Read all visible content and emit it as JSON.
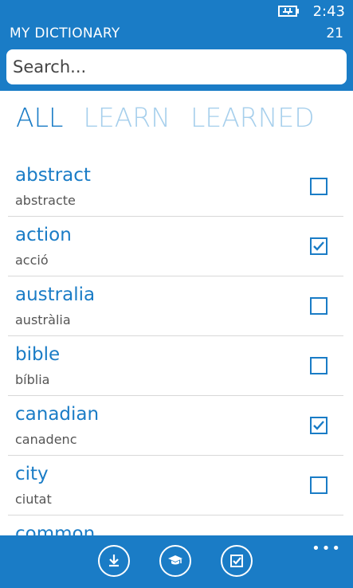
{
  "status": {
    "time": "2:43"
  },
  "header": {
    "title": "MY DICTIONARY",
    "count": "21"
  },
  "search": {
    "placeholder": "Search..."
  },
  "tabs": [
    {
      "label": "ALL",
      "active": true
    },
    {
      "label": "LEARN",
      "active": false
    },
    {
      "label": "LEARNED",
      "active": false
    }
  ],
  "words": [
    {
      "word": "abstract",
      "translation": "abstracte",
      "learned": false
    },
    {
      "word": "action",
      "translation": "acció",
      "learned": true
    },
    {
      "word": "australia",
      "translation": "austràlia",
      "learned": false
    },
    {
      "word": "bible",
      "translation": "bíblia",
      "learned": false
    },
    {
      "word": "canadian",
      "translation": "canadenc",
      "learned": true
    },
    {
      "word": "city",
      "translation": "ciutat",
      "learned": false
    },
    {
      "word": "common",
      "translation": "",
      "learned": false
    }
  ],
  "appbar": {
    "buttons": [
      {
        "icon": "download-icon"
      },
      {
        "icon": "graduation-cap-icon"
      },
      {
        "icon": "checkbox-icon"
      }
    ],
    "more": "•••"
  },
  "colors": {
    "accent": "#1a7cc6",
    "inactive_tab": "#a6cfec"
  }
}
